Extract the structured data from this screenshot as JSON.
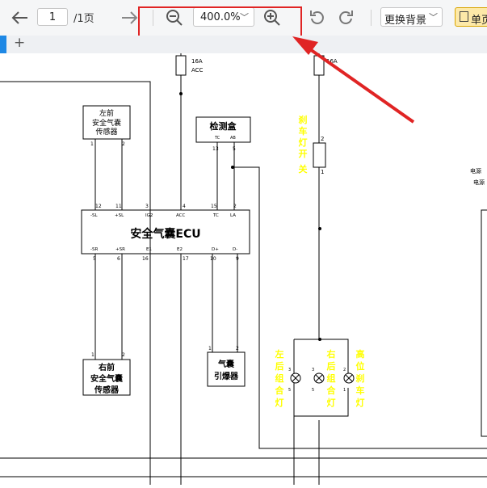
{
  "toolbar": {
    "prev_icon": "arrow-left-icon",
    "page_value": "1",
    "page_total": "/1页",
    "next_icon": "arrow-right-icon",
    "zoom_out_icon": "zoom-out-icon",
    "zoom_value": "400.0%",
    "zoom_in_icon": "zoom-in-icon",
    "rotate_left_icon": "rotate-ccw-icon",
    "rotate_right_icon": "rotate-cw-icon",
    "background_label": "更换背景",
    "single_page_label": "单页",
    "highlight_color": "#e02424"
  },
  "tabbar": {
    "add_tab_icon": "plus-icon",
    "accent_color": "#1e88e5"
  },
  "diagram": {
    "fuse_left": {
      "rating": "16A",
      "name": "ACC"
    },
    "fuse_right": {
      "rating": "16A"
    },
    "front_left_sensor": [
      "左前",
      "安全气囊",
      "传感器"
    ],
    "front_left_pins": [
      "1",
      "2"
    ],
    "check_box": "检测盒",
    "check_box_pins": [
      "TC",
      "AB",
      "13",
      "5"
    ],
    "ecu_label": "安全气囊ECU",
    "ecu_top_pin_nums": [
      "12",
      "11",
      "3",
      "4",
      "15",
      "2"
    ],
    "ecu_top_pin_names": [
      "-SL",
      "+SL",
      "IG2",
      "ACC",
      "TC",
      "LA"
    ],
    "ecu_bottom_pin_names": [
      "-SR",
      "+SR",
      "E1",
      "E2",
      "D+",
      "D-"
    ],
    "ecu_bottom_pin_nums": [
      "5",
      "6",
      "16",
      "17",
      "10",
      "9"
    ],
    "front_right_sensor": [
      "右前",
      "安全气囊",
      "传感器"
    ],
    "front_right_pins": [
      "1",
      "2"
    ],
    "detonator": [
      "气囊",
      "引爆器"
    ],
    "detonator_pins": [
      "1",
      "2"
    ],
    "brake_switch": [
      "刹",
      "车",
      "灯",
      "开",
      "关"
    ],
    "brake_switch_pins": [
      "2",
      "1"
    ],
    "power_label": [
      "电源",
      "电源"
    ],
    "left_rear_lamp": [
      "左",
      "后",
      "组",
      "合",
      "灯"
    ],
    "right_rear_lamp": [
      "右",
      "后",
      "组",
      "合",
      "灯"
    ],
    "high_brake_lamp": [
      "高",
      "位",
      "刹",
      "车",
      "灯"
    ],
    "lamp_pins": [
      "3",
      "5",
      "3",
      "5",
      "2",
      "1"
    ],
    "label_color": "#ffff00"
  }
}
